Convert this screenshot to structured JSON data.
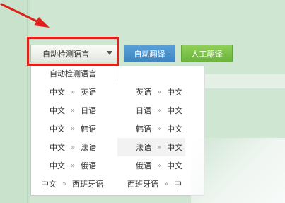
{
  "translator": {
    "select_value": "自动检测语言",
    "machine_button": "自动翻译",
    "human_button": "人工翻译"
  },
  "dropdown": {
    "first_option": "自动检测语言",
    "separator": "»",
    "rows": [
      {
        "left": {
          "from": "中文",
          "to": "英语"
        },
        "right": {
          "from": "英语",
          "to": "中文"
        }
      },
      {
        "left": {
          "from": "中文",
          "to": "日语"
        },
        "right": {
          "from": "日语",
          "to": "中文"
        }
      },
      {
        "left": {
          "from": "中文",
          "to": "韩语"
        },
        "right": {
          "from": "韩语",
          "to": "中文"
        }
      },
      {
        "left": {
          "from": "中文",
          "to": "法语"
        },
        "right": {
          "from": "法语",
          "to": "中文"
        }
      },
      {
        "left": {
          "from": "中文",
          "to": "俄语"
        },
        "right": {
          "from": "俄语",
          "to": "中文"
        }
      },
      {
        "left": {
          "from": "中文",
          "to": "西班牙语"
        },
        "right": {
          "from": "西班牙语",
          "to": "中"
        }
      }
    ]
  },
  "annotation": {
    "highlight_color": "#e0201a",
    "arrow_color": "#e0201a"
  }
}
